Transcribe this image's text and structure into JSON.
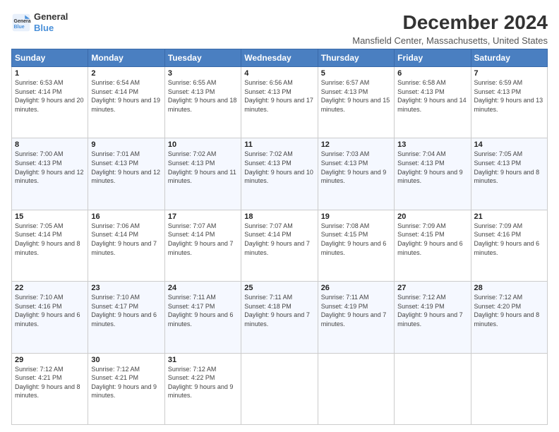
{
  "logo": {
    "line1": "General",
    "line2": "Blue"
  },
  "title": "December 2024",
  "subtitle": "Mansfield Center, Massachusetts, United States",
  "weekdays": [
    "Sunday",
    "Monday",
    "Tuesday",
    "Wednesday",
    "Thursday",
    "Friday",
    "Saturday"
  ],
  "weeks": [
    [
      {
        "day": "1",
        "sunrise": "Sunrise: 6:53 AM",
        "sunset": "Sunset: 4:14 PM",
        "daylight": "Daylight: 9 hours and 20 minutes."
      },
      {
        "day": "2",
        "sunrise": "Sunrise: 6:54 AM",
        "sunset": "Sunset: 4:14 PM",
        "daylight": "Daylight: 9 hours and 19 minutes."
      },
      {
        "day": "3",
        "sunrise": "Sunrise: 6:55 AM",
        "sunset": "Sunset: 4:13 PM",
        "daylight": "Daylight: 9 hours and 18 minutes."
      },
      {
        "day": "4",
        "sunrise": "Sunrise: 6:56 AM",
        "sunset": "Sunset: 4:13 PM",
        "daylight": "Daylight: 9 hours and 17 minutes."
      },
      {
        "day": "5",
        "sunrise": "Sunrise: 6:57 AM",
        "sunset": "Sunset: 4:13 PM",
        "daylight": "Daylight: 9 hours and 15 minutes."
      },
      {
        "day": "6",
        "sunrise": "Sunrise: 6:58 AM",
        "sunset": "Sunset: 4:13 PM",
        "daylight": "Daylight: 9 hours and 14 minutes."
      },
      {
        "day": "7",
        "sunrise": "Sunrise: 6:59 AM",
        "sunset": "Sunset: 4:13 PM",
        "daylight": "Daylight: 9 hours and 13 minutes."
      }
    ],
    [
      {
        "day": "8",
        "sunrise": "Sunrise: 7:00 AM",
        "sunset": "Sunset: 4:13 PM",
        "daylight": "Daylight: 9 hours and 12 minutes."
      },
      {
        "day": "9",
        "sunrise": "Sunrise: 7:01 AM",
        "sunset": "Sunset: 4:13 PM",
        "daylight": "Daylight: 9 hours and 12 minutes."
      },
      {
        "day": "10",
        "sunrise": "Sunrise: 7:02 AM",
        "sunset": "Sunset: 4:13 PM",
        "daylight": "Daylight: 9 hours and 11 minutes."
      },
      {
        "day": "11",
        "sunrise": "Sunrise: 7:02 AM",
        "sunset": "Sunset: 4:13 PM",
        "daylight": "Daylight: 9 hours and 10 minutes."
      },
      {
        "day": "12",
        "sunrise": "Sunrise: 7:03 AM",
        "sunset": "Sunset: 4:13 PM",
        "daylight": "Daylight: 9 hours and 9 minutes."
      },
      {
        "day": "13",
        "sunrise": "Sunrise: 7:04 AM",
        "sunset": "Sunset: 4:13 PM",
        "daylight": "Daylight: 9 hours and 9 minutes."
      },
      {
        "day": "14",
        "sunrise": "Sunrise: 7:05 AM",
        "sunset": "Sunset: 4:13 PM",
        "daylight": "Daylight: 9 hours and 8 minutes."
      }
    ],
    [
      {
        "day": "15",
        "sunrise": "Sunrise: 7:05 AM",
        "sunset": "Sunset: 4:14 PM",
        "daylight": "Daylight: 9 hours and 8 minutes."
      },
      {
        "day": "16",
        "sunrise": "Sunrise: 7:06 AM",
        "sunset": "Sunset: 4:14 PM",
        "daylight": "Daylight: 9 hours and 7 minutes."
      },
      {
        "day": "17",
        "sunrise": "Sunrise: 7:07 AM",
        "sunset": "Sunset: 4:14 PM",
        "daylight": "Daylight: 9 hours and 7 minutes."
      },
      {
        "day": "18",
        "sunrise": "Sunrise: 7:07 AM",
        "sunset": "Sunset: 4:14 PM",
        "daylight": "Daylight: 9 hours and 7 minutes."
      },
      {
        "day": "19",
        "sunrise": "Sunrise: 7:08 AM",
        "sunset": "Sunset: 4:15 PM",
        "daylight": "Daylight: 9 hours and 6 minutes."
      },
      {
        "day": "20",
        "sunrise": "Sunrise: 7:09 AM",
        "sunset": "Sunset: 4:15 PM",
        "daylight": "Daylight: 9 hours and 6 minutes."
      },
      {
        "day": "21",
        "sunrise": "Sunrise: 7:09 AM",
        "sunset": "Sunset: 4:16 PM",
        "daylight": "Daylight: 9 hours and 6 minutes."
      }
    ],
    [
      {
        "day": "22",
        "sunrise": "Sunrise: 7:10 AM",
        "sunset": "Sunset: 4:16 PM",
        "daylight": "Daylight: 9 hours and 6 minutes."
      },
      {
        "day": "23",
        "sunrise": "Sunrise: 7:10 AM",
        "sunset": "Sunset: 4:17 PM",
        "daylight": "Daylight: 9 hours and 6 minutes."
      },
      {
        "day": "24",
        "sunrise": "Sunrise: 7:11 AM",
        "sunset": "Sunset: 4:17 PM",
        "daylight": "Daylight: 9 hours and 6 minutes."
      },
      {
        "day": "25",
        "sunrise": "Sunrise: 7:11 AM",
        "sunset": "Sunset: 4:18 PM",
        "daylight": "Daylight: 9 hours and 7 minutes."
      },
      {
        "day": "26",
        "sunrise": "Sunrise: 7:11 AM",
        "sunset": "Sunset: 4:19 PM",
        "daylight": "Daylight: 9 hours and 7 minutes."
      },
      {
        "day": "27",
        "sunrise": "Sunrise: 7:12 AM",
        "sunset": "Sunset: 4:19 PM",
        "daylight": "Daylight: 9 hours and 7 minutes."
      },
      {
        "day": "28",
        "sunrise": "Sunrise: 7:12 AM",
        "sunset": "Sunset: 4:20 PM",
        "daylight": "Daylight: 9 hours and 8 minutes."
      }
    ],
    [
      {
        "day": "29",
        "sunrise": "Sunrise: 7:12 AM",
        "sunset": "Sunset: 4:21 PM",
        "daylight": "Daylight: 9 hours and 8 minutes."
      },
      {
        "day": "30",
        "sunrise": "Sunrise: 7:12 AM",
        "sunset": "Sunset: 4:21 PM",
        "daylight": "Daylight: 9 hours and 9 minutes."
      },
      {
        "day": "31",
        "sunrise": "Sunrise: 7:12 AM",
        "sunset": "Sunset: 4:22 PM",
        "daylight": "Daylight: 9 hours and 9 minutes."
      },
      null,
      null,
      null,
      null
    ]
  ]
}
